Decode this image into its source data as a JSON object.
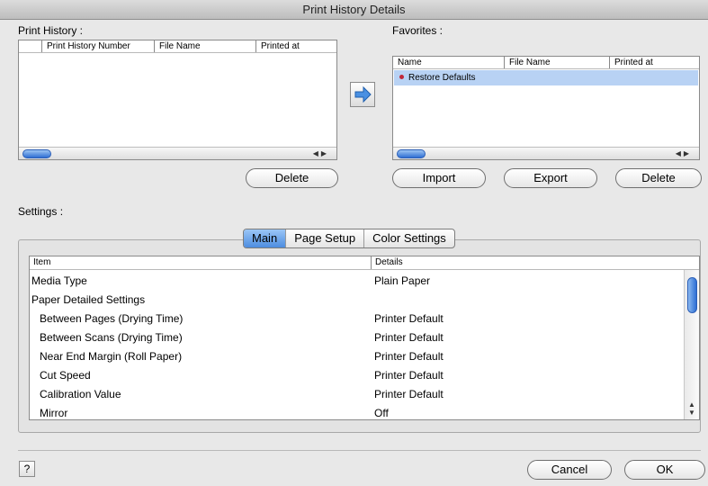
{
  "window": {
    "title": "Print History Details"
  },
  "print_history": {
    "label": "Print History :",
    "columns": [
      "Print History Number",
      "File Name",
      "Printed at"
    ],
    "delete_label": "Delete"
  },
  "transfer_icon": "right-arrow-icon",
  "favorites": {
    "label": "Favorites :",
    "columns": [
      "Name",
      "File Name",
      "Printed at"
    ],
    "rows": [
      {
        "name": "Restore Defaults"
      }
    ],
    "import_label": "Import",
    "export_label": "Export",
    "delete_label": "Delete"
  },
  "settings": {
    "label": "Settings :",
    "tabs": [
      "Main",
      "Page Setup",
      "Color Settings"
    ],
    "active_tab": "Main",
    "columns": [
      "Item",
      "Details"
    ],
    "rows": [
      {
        "item": "Media Type",
        "details": "Plain Paper"
      },
      {
        "item": "Paper Detailed Settings",
        "details": ""
      },
      {
        "item": "Between Pages (Drying Time)",
        "details": "Printer Default"
      },
      {
        "item": "Between Scans (Drying Time)",
        "details": "Printer Default"
      },
      {
        "item": "Near End Margin (Roll Paper)",
        "details": "Printer Default"
      },
      {
        "item": "Cut Speed",
        "details": "Printer Default"
      },
      {
        "item": "Calibration Value",
        "details": "Printer Default"
      },
      {
        "item": "Mirror",
        "details": "Off"
      }
    ]
  },
  "footer": {
    "help_icon": "help-icon",
    "cancel_label": "Cancel",
    "ok_label": "OK"
  }
}
